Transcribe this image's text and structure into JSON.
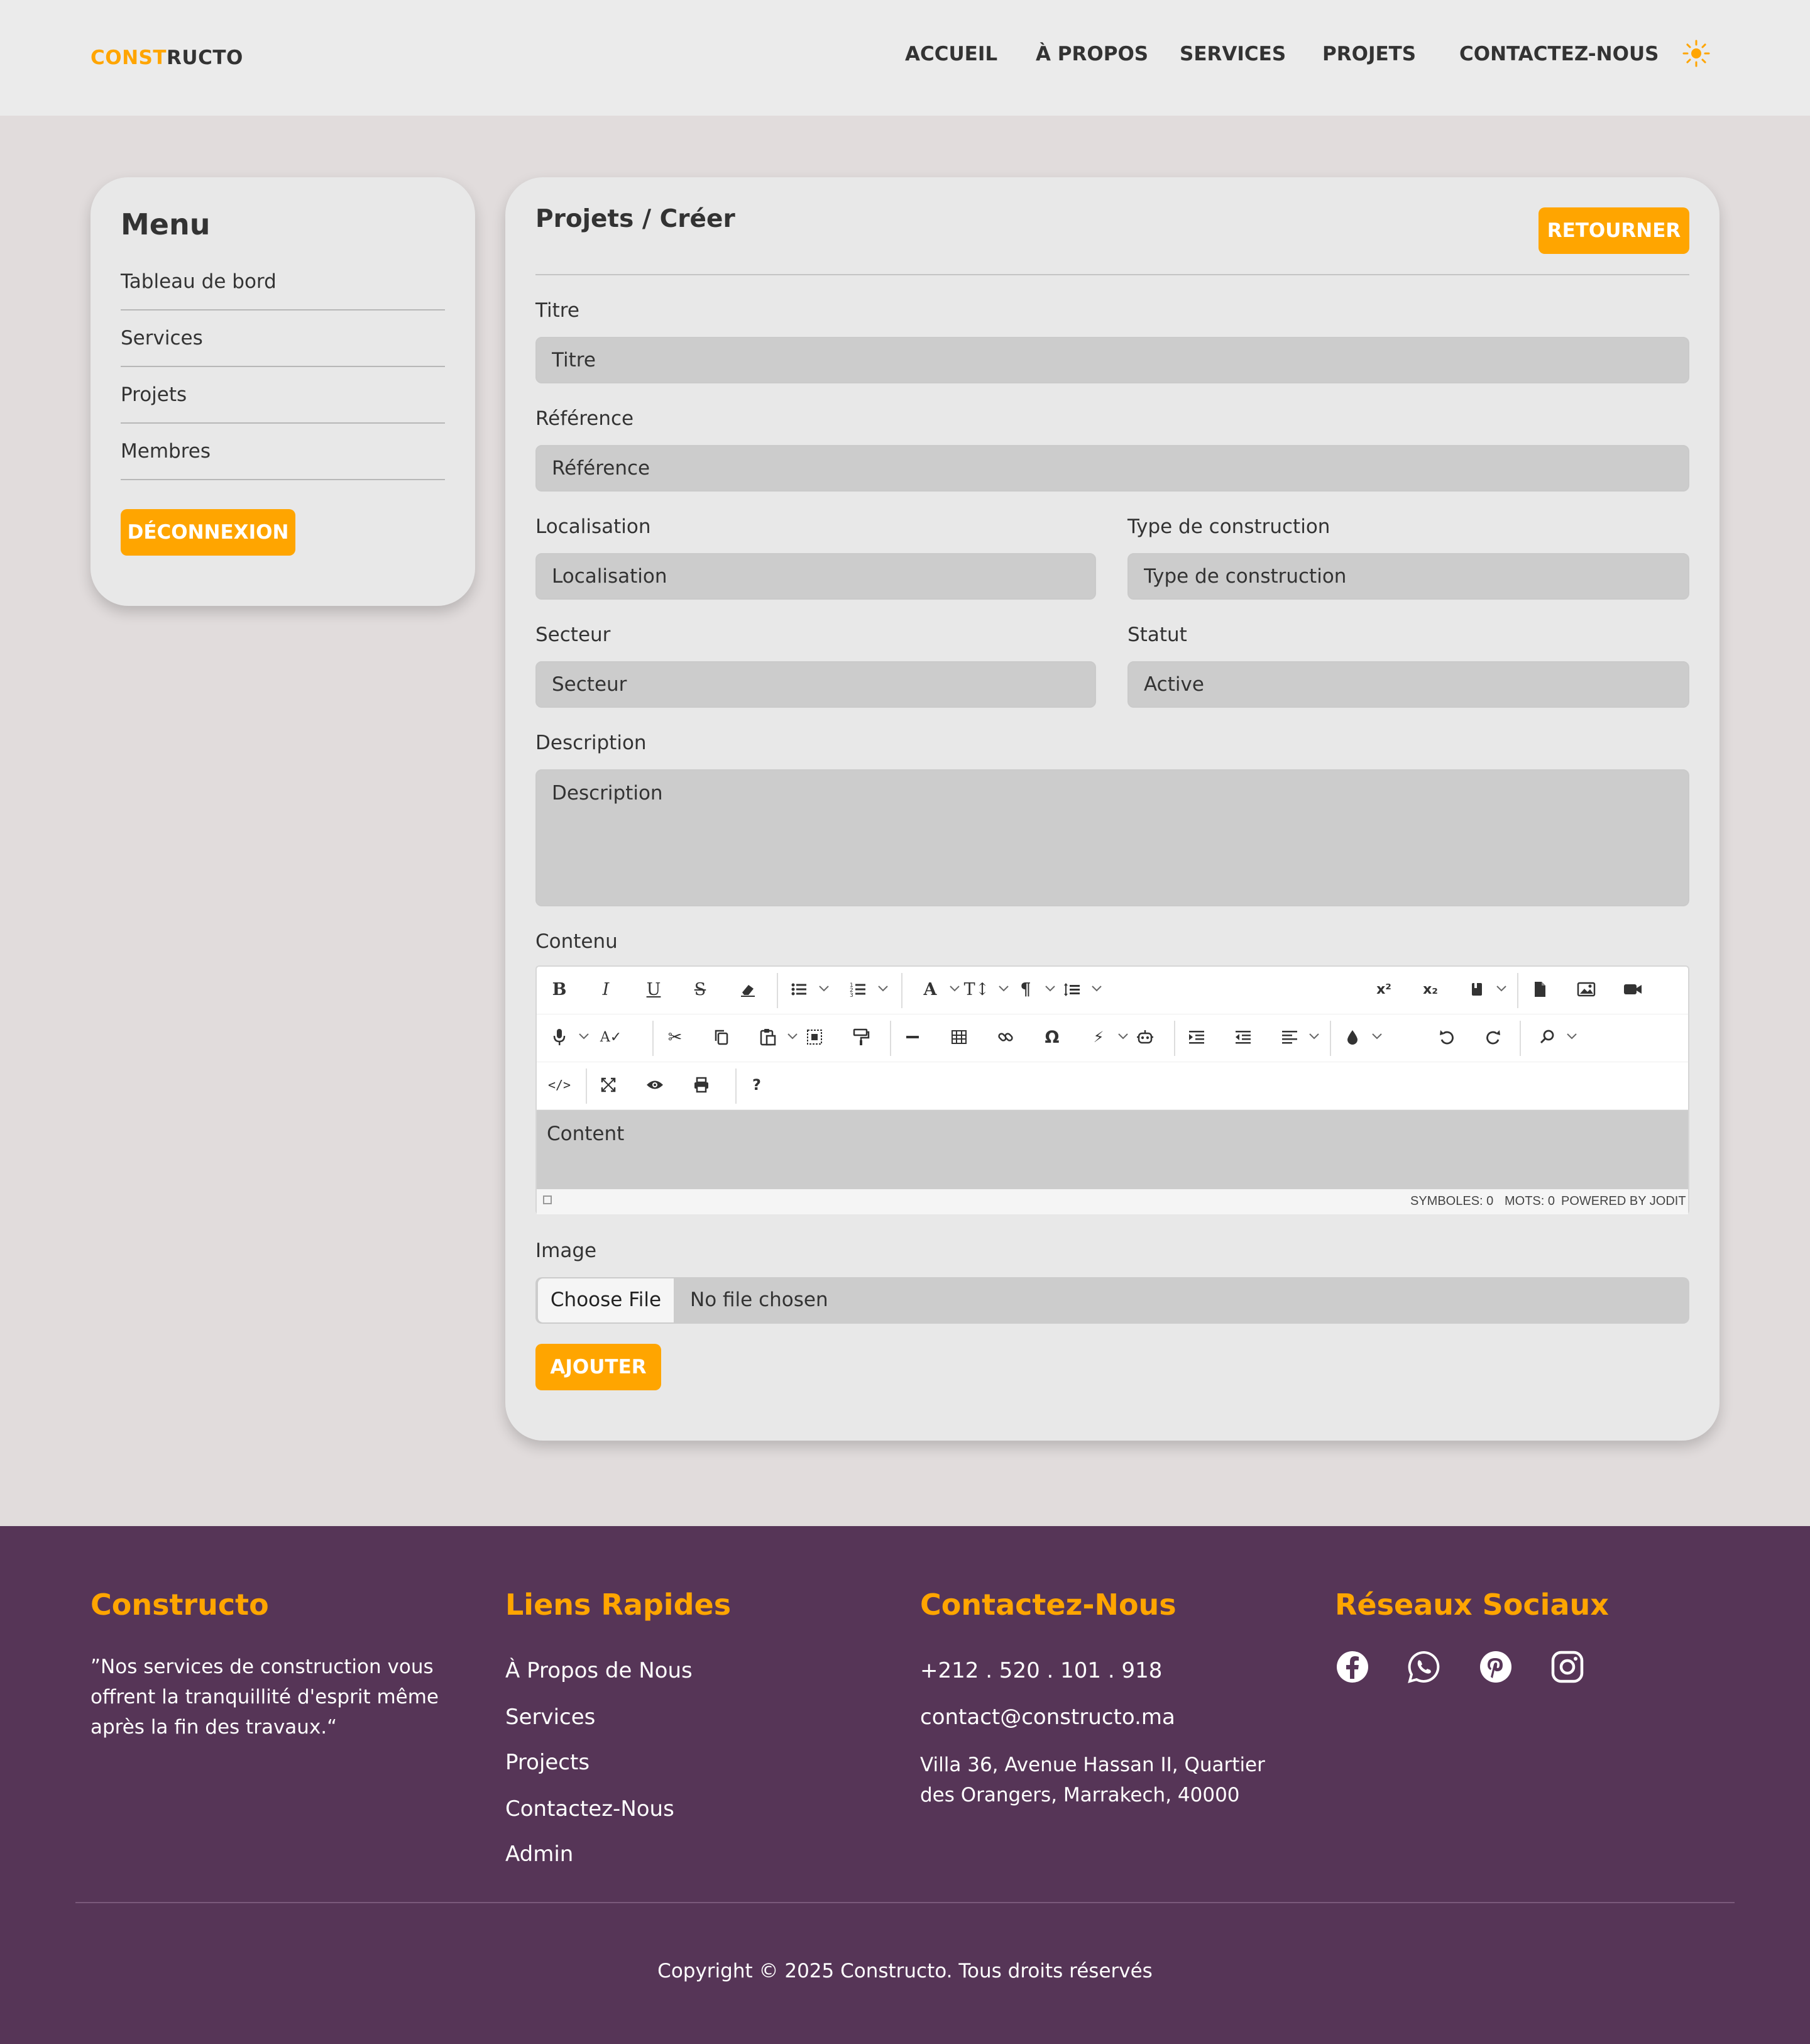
{
  "header": {
    "logo_part1": "CONST",
    "logo_part2": "RUCTO",
    "nav": [
      "ACCUEIL",
      "À PROPOS",
      "SERVICES",
      "PROJETS",
      "CONTACTEZ-NOUS"
    ],
    "theme_icon": "sun-icon"
  },
  "sidebar": {
    "title": "Menu",
    "items": [
      "Tableau de bord",
      "Services",
      "Projets",
      "Membres"
    ],
    "logout_label": "DÉCONNEXION"
  },
  "main": {
    "title": "Projets / Créer",
    "back_label": "RETOURNER",
    "fields": {
      "titre": {
        "label": "Titre",
        "placeholder": "Titre"
      },
      "reference": {
        "label": "Référence",
        "placeholder": "Référence"
      },
      "localisation": {
        "label": "Localisation",
        "placeholder": "Localisation"
      },
      "type": {
        "label": "Type de construction",
        "placeholder": "Type de construction"
      },
      "secteur": {
        "label": "Secteur",
        "placeholder": "Secteur"
      },
      "statut": {
        "label": "Statut",
        "value": "Active"
      },
      "description": {
        "label": "Description",
        "placeholder": "Description"
      }
    },
    "contenu_label": "Contenu",
    "editor": {
      "content": "Content",
      "status_symbols": "SYMBOLES: 0",
      "status_words": "MOTS: 0",
      "status_powered": "POWERED BY JODIT"
    },
    "image_label": "Image",
    "file_button": "Choose File",
    "file_status": "No file chosen",
    "submit_label": "AJOUTER"
  },
  "footer": {
    "brand_title": "Constructo",
    "brand_quote": "”Nos services de construction vous offrent la tranquillité d'esprit même après la fin des travaux.“",
    "links_title": "Liens Rapides",
    "links": [
      "À Propos de Nous",
      "Services",
      "Projects",
      "Contactez-Nous",
      "Admin"
    ],
    "contact_title": "Contactez-Nous",
    "phone": "+212 . 520 . 101 . 918",
    "email": "contact@constructo.ma",
    "address": "Villa 36, Avenue Hassan II, Quartier des Orangers, Marrakech, 40000",
    "social_title": "Réseaux Sociaux",
    "social_icons": [
      "facebook-icon",
      "whatsapp-icon",
      "pinterest-icon",
      "instagram-icon"
    ],
    "copyright": "Copyright © 2025 Constructo. Tous droits réservés"
  },
  "colors": {
    "accent": "#ffa500",
    "footer_bg": "#563557",
    "page_bg": "#e1dcdc",
    "card_bg": "#e8e8e8"
  }
}
